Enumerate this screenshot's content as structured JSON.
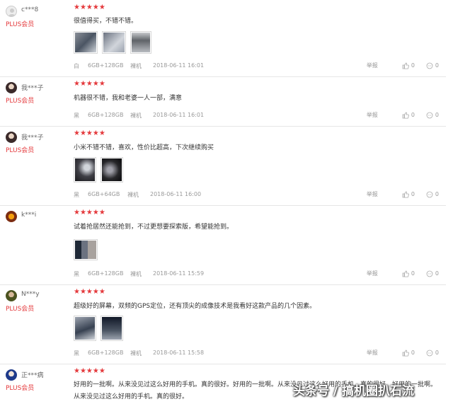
{
  "reviews": [
    {
      "user": "c***8",
      "badge": "PLUS会员",
      "stars": "★★★★★",
      "text": "很值得买，不错不错。",
      "color": "白",
      "version": "6GB+128GB",
      "kind": "裸机",
      "date": "2018-06-11 16:01",
      "report": "举报",
      "likes": "0",
      "replies": "0"
    },
    {
      "user": "我***子",
      "badge": "PLUS会员",
      "stars": "★★★★★",
      "text": "机器很不错，我和老婆一人一部，满意",
      "color": "黑",
      "version": "6GB+128GB",
      "kind": "裸机",
      "date": "2018-06-11 16:01",
      "report": "举报",
      "likes": "0",
      "replies": "0"
    },
    {
      "user": "我***子",
      "badge": "PLUS会员",
      "stars": "★★★★★",
      "text": "小米不错不错，喜欢，性价比超高，下次继续购买",
      "color": "黑",
      "version": "6GB+64GB",
      "kind": "裸机",
      "date": "2018-06-11 16:00",
      "report": "举报",
      "likes": "0",
      "replies": "0"
    },
    {
      "user": "k***i",
      "badge": "",
      "stars": "★★★★★",
      "text": "试着抢居然还能抢到，不过更想要探索版，希望能抢到。",
      "color": "黑",
      "version": "6GB+128GB",
      "kind": "裸机",
      "date": "2018-06-11 15:59",
      "report": "举报",
      "likes": "0",
      "replies": "0"
    },
    {
      "user": "N***y",
      "badge": "PLUS会员",
      "stars": "★★★★★",
      "text": "超级好的屏幕，双频的GPS定位，还有顶尖的成像技术是我看好这款产品的几个因素。",
      "color": "黑",
      "version": "6GB+128GB",
      "kind": "裸机",
      "date": "2018-06-11 15:58",
      "report": "举报",
      "likes": "0",
      "replies": "0"
    },
    {
      "user": "正***病",
      "badge": "PLUS会员",
      "stars": "★★★★★",
      "text": "好用的一批啊。从来没见过这么好用的手机。真的很好。好用的一批啊。从来没见过这么好用的手机。真的很好。好用的一批啊。",
      "text2": "从来没见过这么好用的手机。真的很好。"
    }
  ],
  "watermark": "头条号 / 搞机圈扒石流",
  "colors": {
    "accent": "#e4393c",
    "muted": "#999999",
    "divider": "#e6e6e6"
  }
}
